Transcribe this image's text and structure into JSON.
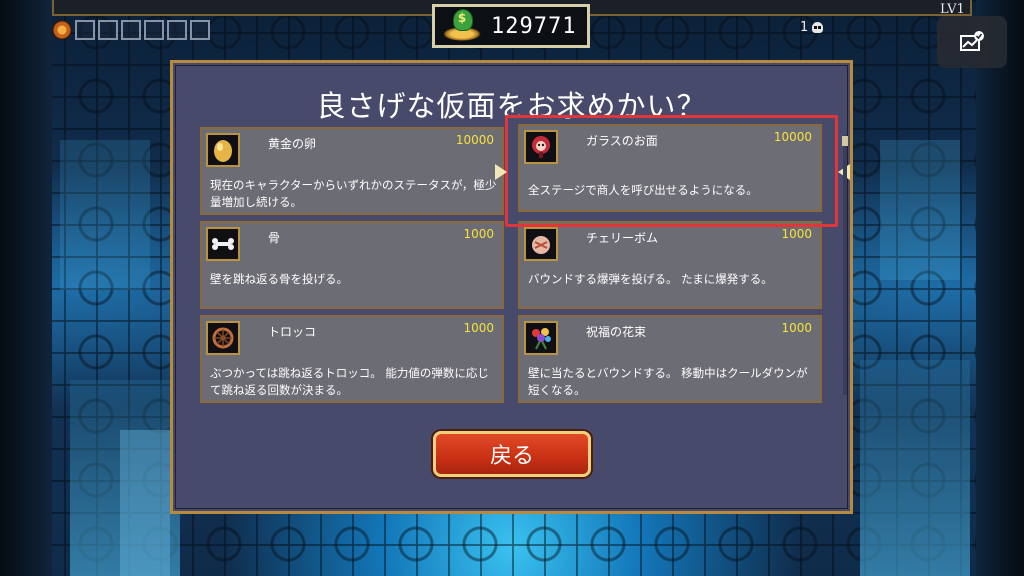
{
  "hud": {
    "coins": "129771",
    "level": "LV1",
    "deaths": "1"
  },
  "shop": {
    "title": "良さげな仮面をお求めかい？",
    "items": [
      {
        "name": "黄金の卵",
        "price": "10000",
        "desc": "現在のキャラクターからいずれかのステータスが，極少量増加し続ける。",
        "icon": "golden-egg-icon"
      },
      {
        "name": "ガラスのお面",
        "price": "10000",
        "desc": "全ステージで商人を呼び出せるようになる。",
        "icon": "glass-mask-icon"
      },
      {
        "name": "骨",
        "price": "1000",
        "desc": "壁を跳ね返る骨を投げる。",
        "icon": "bone-icon"
      },
      {
        "name": "チェリーボム",
        "price": "1000",
        "desc": "バウンドする爆弾を投げる。 たまに爆発する。",
        "icon": "cherry-bomb-icon"
      },
      {
        "name": "トロッコ",
        "price": "1000",
        "desc": "ぶつかっては跳ね返るトロッコ。 能力値の弾数に応じて跳ね返る回数が決まる。",
        "icon": "trolley-icon"
      },
      {
        "name": "祝福の花束",
        "price": "1000",
        "desc": "壁に当たるとバウンドする。 移動中はクールダウンが短くなる。",
        "icon": "bouquet-icon"
      }
    ],
    "back_label": "戻る"
  },
  "colors": {
    "panel": "#474a6b",
    "card": "#6c6c74",
    "price": "#f7e23a",
    "highlight": "#e2353a",
    "back_button": "#c93014"
  }
}
